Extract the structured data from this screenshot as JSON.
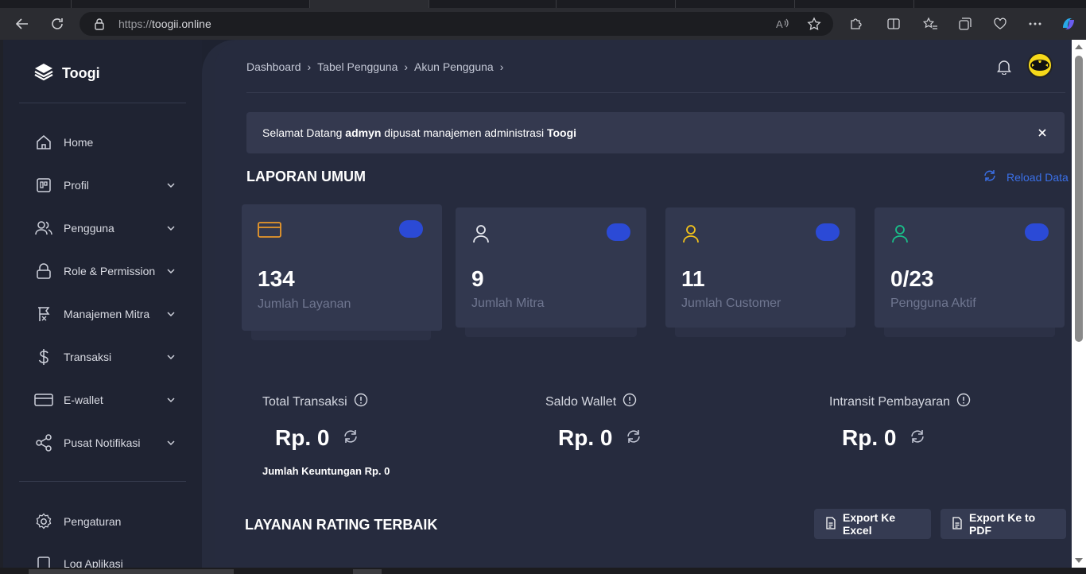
{
  "browser": {
    "url_prefix": "https://",
    "url_domain": "toogii.online"
  },
  "sidebar": {
    "brand": "Toogi",
    "items": [
      {
        "label": "Home",
        "icon": "home-icon",
        "expandable": false
      },
      {
        "label": "Profil",
        "icon": "profile-card-icon",
        "expandable": true
      },
      {
        "label": "Pengguna",
        "icon": "users-icon",
        "expandable": true
      },
      {
        "label": "Role & Permission",
        "icon": "lock-icon",
        "expandable": true
      },
      {
        "label": "Manajemen Mitra",
        "icon": "partner-icon",
        "expandable": true
      },
      {
        "label": "Transaksi",
        "icon": "dollar-icon",
        "expandable": true
      },
      {
        "label": "E-wallet",
        "icon": "wallet-card-icon",
        "expandable": true
      },
      {
        "label": "Pusat Notifikasi",
        "icon": "share-icon",
        "expandable": true
      }
    ],
    "bottom_items": [
      {
        "label": "Pengaturan",
        "icon": "gear-icon"
      },
      {
        "label": "Log Aplikasi",
        "icon": "log-icon"
      }
    ]
  },
  "header": {
    "breadcrumb": [
      "Dashboard",
      "Tabel Pengguna",
      "Akun Pengguna"
    ]
  },
  "alert": {
    "prefix": "Selamat Datang ",
    "user": "admyn",
    "middle": " dipusat manajemen administrasi ",
    "app": "Toogi"
  },
  "report": {
    "title": "LAPORAN UMUM",
    "reload_label": "Reload Data",
    "cards": [
      {
        "value": "134",
        "label": "Jumlah Layanan",
        "icon_color": "#e9982a"
      },
      {
        "value": "9",
        "label": "Jumlah Mitra",
        "icon_color": "#e6e8ef"
      },
      {
        "value": "11",
        "label": "Jumlah Customer",
        "icon_color": "#f2c21b"
      },
      {
        "value": "0/23",
        "label": "Pengguna Aktif",
        "icon_color": "#19c08a"
      }
    ]
  },
  "finance": [
    {
      "title": "Total Transaksi",
      "value": "Rp. 0"
    },
    {
      "title": "Saldo Wallet",
      "value": "Rp. 0"
    },
    {
      "title": "Intransit Pembayaran",
      "value": "Rp. 0"
    }
  ],
  "keuntungan": {
    "label": "Jumlah Keuntungan",
    "value": "Rp. 0"
  },
  "rating": {
    "title": "LAYANAN RATING TERBAIK",
    "export_excel": "Export Ke Excel",
    "export_pdf": "Export Ke to PDF"
  },
  "colors": {
    "accent": "#2b4ad6",
    "link": "#3a6fe6",
    "background": "#262b3e"
  }
}
